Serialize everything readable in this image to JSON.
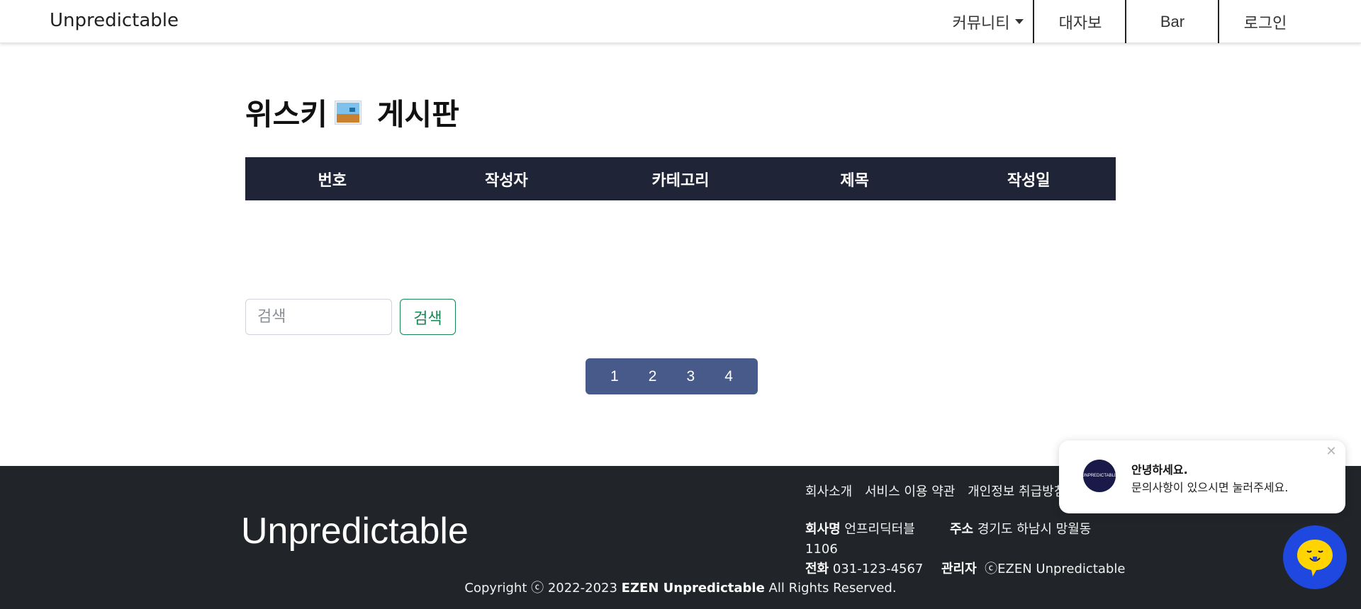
{
  "navbar": {
    "brand": "Unpredictable",
    "items": [
      {
        "label": "커뮤니티"
      },
      {
        "label": "대자보"
      },
      {
        "label": "Bar"
      },
      {
        "label": "로그인"
      }
    ]
  },
  "page": {
    "title_part1": "위스키",
    "title_part2": "게시판",
    "title_image_icon": "image-icon"
  },
  "table": {
    "headers": [
      "번호",
      "작성자",
      "카테고리",
      "제목",
      "작성일"
    ],
    "rows": []
  },
  "search": {
    "placeholder": "검색",
    "button_label": "검색"
  },
  "pagination": {
    "pages": [
      "1",
      "2",
      "3",
      "4"
    ]
  },
  "footer": {
    "brand": "Unpredictable",
    "links": [
      "회사소개",
      "서비스 이용 약관",
      "개인정보 취급방침"
    ],
    "company_label": "회사명",
    "company_value": "언프리딕터블",
    "address_label": "주소",
    "address_value": "경기도 하남시 망월동",
    "address_value2": "1106",
    "phone_label": "전화",
    "phone_value": "031-123-4567",
    "admin_label": "관리자",
    "admin_value": "ⓒEZEN Unpredictable",
    "copyright_prefix": "Copyright ⓒ 2022-2023",
    "copyright_bold": "EZEN Unpredictable",
    "copyright_suffix": "All Rights Reserved."
  },
  "chat": {
    "avatar_text": "UNPREDICTABLE",
    "title": "안녕하세요.",
    "body": "문의사항이 있으시면 눌러주세요.",
    "fab_color": "#1f48e0",
    "fab_icon": "chat-bubble-icon"
  },
  "colors": {
    "table_header": "#1f2437",
    "pagination": "#475a8a",
    "footer": "#212529",
    "search_button": "#198754"
  }
}
